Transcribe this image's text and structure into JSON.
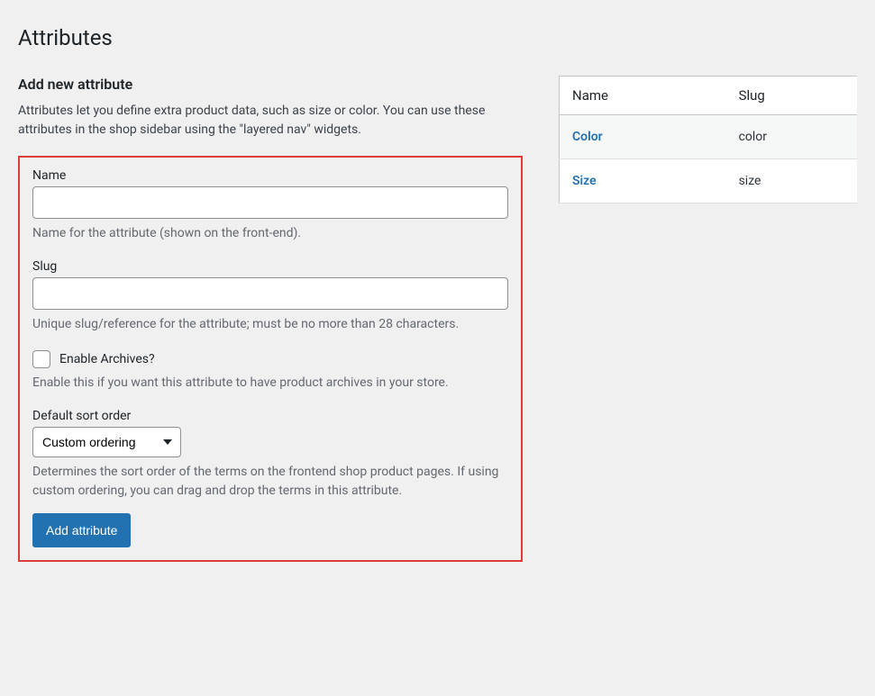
{
  "page": {
    "title": "Attributes"
  },
  "form": {
    "heading": "Add new attribute",
    "intro": "Attributes let you define extra product data, such as size or color. You can use these attributes in the shop sidebar using the \"layered nav\" widgets.",
    "name": {
      "label": "Name",
      "value": "",
      "description": "Name for the attribute (shown on the front-end)."
    },
    "slug": {
      "label": "Slug",
      "value": "",
      "description": "Unique slug/reference for the attribute; must be no more than 28 characters."
    },
    "archives": {
      "label": "Enable Archives?",
      "description": "Enable this if you want this attribute to have product archives in your store."
    },
    "sort": {
      "label": "Default sort order",
      "selected": "Custom ordering",
      "description": "Determines the sort order of the terms on the frontend shop product pages. If using custom ordering, you can drag and drop the terms in this attribute."
    },
    "submit_label": "Add attribute"
  },
  "table": {
    "headers": {
      "name": "Name",
      "slug": "Slug"
    },
    "rows": [
      {
        "name": "Color",
        "slug": "color"
      },
      {
        "name": "Size",
        "slug": "size"
      }
    ]
  }
}
